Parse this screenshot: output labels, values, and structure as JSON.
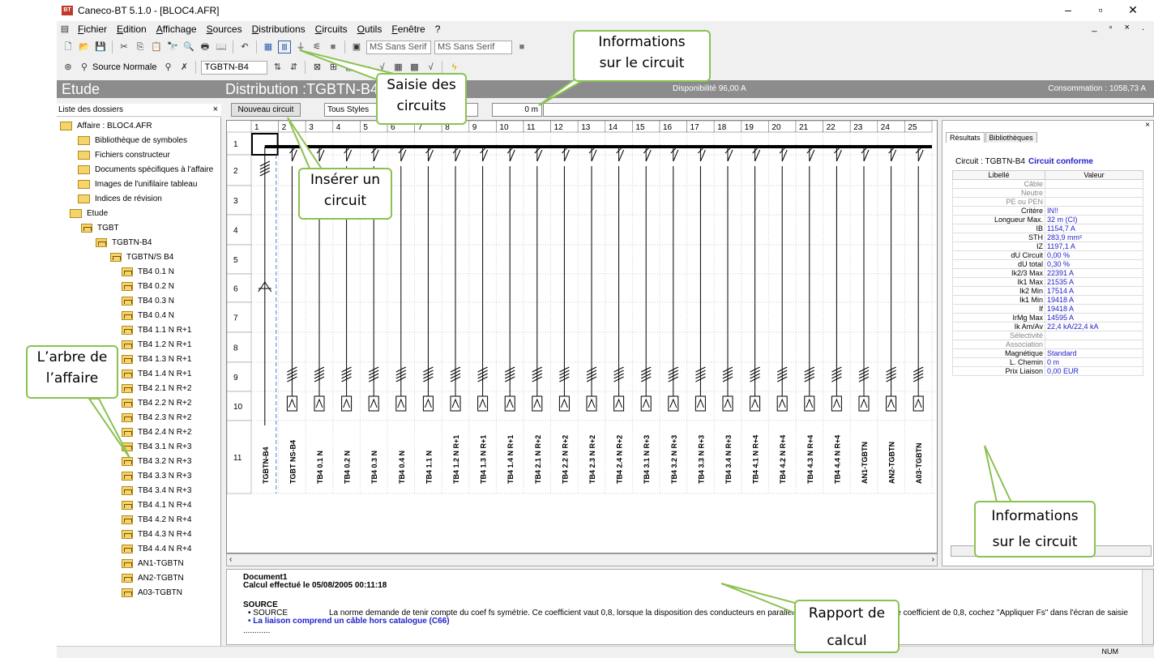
{
  "window": {
    "title": "Caneco-BT 5.1.0 - [BLOC4.AFR]",
    "icon": "app-icon",
    "controls": [
      "–",
      "▫",
      "✕"
    ]
  },
  "menu": {
    "items": [
      "Fichier",
      "Edition",
      "Affichage",
      "Sources",
      "Distributions",
      "Circuits",
      "Outils",
      "Fenêtre",
      "?"
    ],
    "mdi": "_ ▫ × ."
  },
  "toolbar": {
    "font_combo": "MS Sans Serif",
    "font_combo2": "MS Sans Serif",
    "source_label": "Source Normale",
    "tgbtn_combo": "TGBTN-B4"
  },
  "header": {
    "etude": "Etude",
    "distribution": "Distribution :TGBTN-B4",
    "dispo": "Disponibilité 96,00 A",
    "conso": "Consommation : 1058,73 A"
  },
  "left_panel": {
    "title": "Liste des dossiers",
    "close": "×"
  },
  "tree": [
    {
      "label": "Affaire : BLOC4.AFR",
      "kind": "folder"
    },
    {
      "label": "Bibliothèque de symboles",
      "kind": "folder"
    },
    {
      "label": "Fichiers constructeur",
      "kind": "folder"
    },
    {
      "label": "Documents spécifiques à l'affaire",
      "kind": "folder"
    },
    {
      "label": "Images de l'unifilaire tableau",
      "kind": "folder"
    },
    {
      "label": "Indices de révision",
      "kind": "folder"
    },
    {
      "label": "Etude",
      "kind": "folder"
    },
    {
      "label": "TGBT",
      "kind": "dist"
    },
    {
      "label": "TGBTN-B4",
      "kind": "dist"
    },
    {
      "label": "TGBTN/S B4",
      "kind": "dist"
    },
    {
      "label": "TB4 0.1 N",
      "kind": "dist"
    },
    {
      "label": "TB4 0.2 N",
      "kind": "dist"
    },
    {
      "label": "TB4 0.3 N",
      "kind": "dist"
    },
    {
      "label": "TB4 0.4 N",
      "kind": "dist"
    },
    {
      "label": "TB4 1.1 N R+1",
      "kind": "dist"
    },
    {
      "label": "TB4 1.2 N R+1",
      "kind": "dist"
    },
    {
      "label": "TB4 1.3 N R+1",
      "kind": "dist"
    },
    {
      "label": "TB4 1.4 N R+1",
      "kind": "dist"
    },
    {
      "label": "TB4 2.1 N R+2",
      "kind": "dist"
    },
    {
      "label": "TB4 2.2 N R+2",
      "kind": "dist"
    },
    {
      "label": "TB4 2.3 N R+2",
      "kind": "dist"
    },
    {
      "label": "TB4 2.4 N R+2",
      "kind": "dist"
    },
    {
      "label": "TB4 3.1 N R+3",
      "kind": "dist"
    },
    {
      "label": "TB4 3.2 N R+3",
      "kind": "dist"
    },
    {
      "label": "TB4 3.3 N R+3",
      "kind": "dist"
    },
    {
      "label": "TB4 3.4 N R+3",
      "kind": "dist"
    },
    {
      "label": "TB4 4.1 N R+4",
      "kind": "dist"
    },
    {
      "label": "TB4 4.2 N R+4",
      "kind": "dist"
    },
    {
      "label": "TB4 4.3 N R+4",
      "kind": "dist"
    },
    {
      "label": "TB4 4.4 N R+4",
      "kind": "dist"
    },
    {
      "label": "AN1-TGBTN",
      "kind": "dist"
    },
    {
      "label": "AN2-TGBTN",
      "kind": "dist"
    },
    {
      "label": "A03-TGBTN",
      "kind": "dist"
    }
  ],
  "circuit_toolbar": {
    "new_circuit": "Nouveau circuit",
    "style": "Tous Styles",
    "length": "0 m"
  },
  "grid": {
    "columns": [
      "1",
      "2",
      "3",
      "4",
      "5",
      "6",
      "7",
      "8",
      "9",
      "10",
      "11",
      "12",
      "13",
      "14",
      "15",
      "16",
      "17",
      "18",
      "19",
      "20",
      "21",
      "22",
      "23",
      "24",
      "25"
    ],
    "rows": [
      "1",
      "2",
      "3",
      "4",
      "5",
      "6",
      "7",
      "8",
      "9",
      "10",
      "11"
    ],
    "circuit_labels": [
      "TGBTN-B4",
      "TGBT NS-B4",
      "TB4 0.1 N",
      "TB4 0.2 N",
      "TB4 0.3 N",
      "TB4 0.4 N",
      "TB4 1.1 N",
      "TB4 1.2 N R+1",
      "TB4 1.3 N R+1",
      "TB4 1.4 N R+1",
      "TB4 2.1 N R+2",
      "TB4 2.2 N R+2",
      "TB4 2.3 N R+2",
      "TB4 2.4 N R+2",
      "TB4 3.1 N R+3",
      "TB4 3.2 N R+3",
      "TB4 3.3 N R+3",
      "TB4 3.4 N R+3",
      "TB4 4.1 N R+4",
      "TB4 4.2 N R+4",
      "TB4 4.3 N R+4",
      "TB4 4.4 N R+4",
      "AN1-TGBTN",
      "AN2-TGBTN",
      "A03-TGBTN"
    ]
  },
  "results": {
    "tabs": [
      "Résultats",
      "Bibliothèques"
    ],
    "circuit_label": "Circuit : TGBTN-B4",
    "status": "Circuit conforme",
    "col_libelle": "Libellé",
    "col_valeur": "Valeur",
    "rows": [
      {
        "label": "Câble",
        "value": "",
        "muted": true
      },
      {
        "label": "Neutre",
        "value": "",
        "muted": true
      },
      {
        "label": "PE ou PEN",
        "value": "",
        "muted": true
      },
      {
        "label": "Critère",
        "value": "IN!!"
      },
      {
        "label": "Longueur Max.",
        "value": "32 m (CI)"
      },
      {
        "label": "IB",
        "value": "1154,7 A"
      },
      {
        "label": "STH",
        "value": "283,9 mm²"
      },
      {
        "label": "IZ",
        "value": "1197,1 A"
      },
      {
        "label": "dU Circuit",
        "value": "0,00 %"
      },
      {
        "label": "dU total",
        "value": "0,30 %"
      },
      {
        "label": "Ik2/3 Max",
        "value": "22391 A"
      },
      {
        "label": "Ik1 Max",
        "value": "21535 A"
      },
      {
        "label": "Ik2 Min",
        "value": "17514 A"
      },
      {
        "label": "Ik1 Min",
        "value": "19418 A"
      },
      {
        "label": "If",
        "value": "19418 A"
      },
      {
        "label": "IrMg Max",
        "value": "14595 A"
      },
      {
        "label": "Ik Am/Av",
        "value": "22,4 kA/22,4 kA"
      },
      {
        "label": "Sélectivité",
        "value": "",
        "muted": true
      },
      {
        "label": "Association",
        "value": "",
        "muted": true
      },
      {
        "label": "Magnétique",
        "value": "Standard"
      },
      {
        "label": "L. Chemin",
        "value": "0 m"
      },
      {
        "label": "Prix Liaison",
        "value": "0,00 EUR"
      }
    ]
  },
  "report": {
    "doc": "Document1",
    "calc": "Calcul effectué le 05/08/2005 00:11:18",
    "section": "SOURCE",
    "line1_key": "SOURCE",
    "line1_text": "La norme demande de tenir compte du coef fs symétrie. Ce coefficient vaut 0,8, lorsque la disposition des conducteurs en parallèle n'est",
    "line1_tail": "uer ce coefficient de 0,8, cochez \"Appliquer Fs\" dans l'écran de saisie",
    "line2": "La liaison comprend un câble hors catalogue (C66)",
    "dots": "............"
  },
  "status": {
    "num": "NUM"
  },
  "callouts": {
    "info_top": [
      "Informations",
      "sur le circuit"
    ],
    "saisie": [
      "Saisie des",
      "circuits"
    ],
    "inserer": [
      "Insérer un",
      "circuit"
    ],
    "arbre": [
      "L’arbre de",
      "l’affaire"
    ],
    "info_right": [
      "Informations",
      "sur le circuit"
    ],
    "rapport": [
      "Rapport de",
      "calcul"
    ]
  },
  "colors": {
    "callout_border": "#8cc152",
    "header_gray": "#8c8c8c",
    "value_blue": "#2222cc"
  }
}
